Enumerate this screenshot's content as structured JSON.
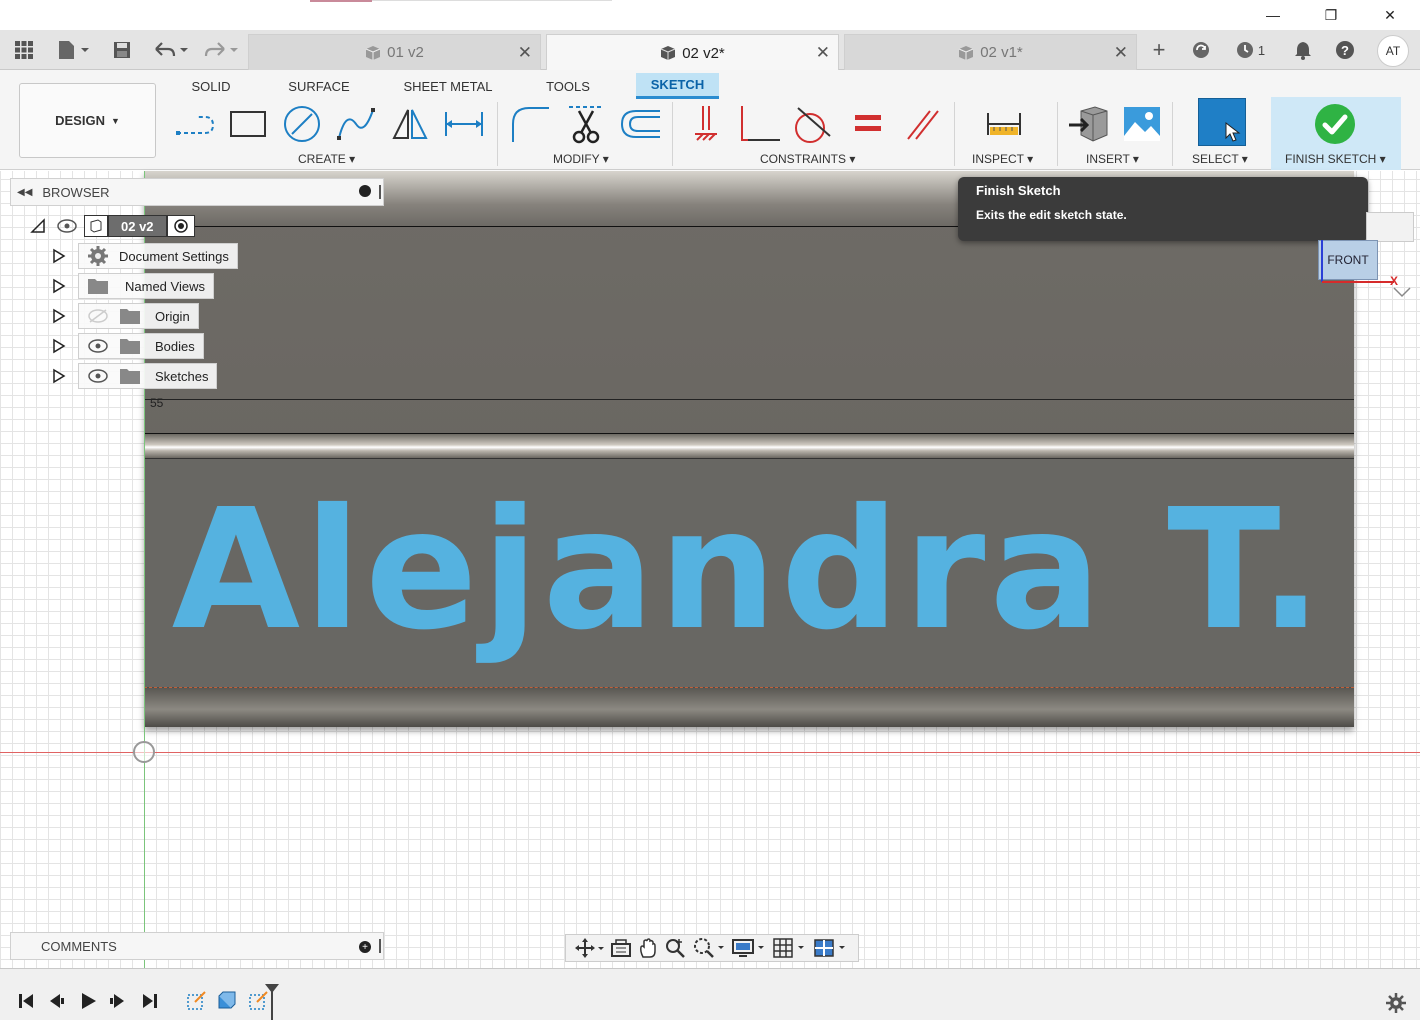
{
  "window": {
    "minimize": "—",
    "restore": "❐",
    "close": "✕"
  },
  "quick_access": {
    "apps_icon": "grid-icon",
    "file_icon": "file-icon",
    "save_icon": "save-icon",
    "undo_icon": "undo-icon",
    "redo_icon": "redo-icon"
  },
  "tabs": [
    {
      "label": "01 v2",
      "active": false
    },
    {
      "label": "02 v2*",
      "active": true
    },
    {
      "label": "02 v1*",
      "active": false
    }
  ],
  "top_right": {
    "job_count": "1",
    "user_initials": "AT"
  },
  "ribbon": {
    "workspace": "DESIGN",
    "tabs": [
      "SOLID",
      "SURFACE",
      "SHEET METAL",
      "TOOLS",
      "SKETCH"
    ],
    "active_tab": "SKETCH",
    "groups": {
      "create": "CREATE",
      "modify": "MODIFY",
      "constraints": "CONSTRAINTS",
      "inspect": "INSPECT",
      "insert": "INSERT",
      "select": "SELECT",
      "finish": "FINISH SKETCH"
    },
    "accent_color": "#2a8cd0"
  },
  "browser": {
    "title": "BROWSER",
    "root": "02 v2",
    "items": [
      {
        "label": "Document Settings",
        "icon": "gear-icon"
      },
      {
        "label": "Named Views",
        "icon": "folder-icon"
      },
      {
        "label": "Origin",
        "icon": "folder-icon",
        "visibility": "hidden"
      },
      {
        "label": "Bodies",
        "icon": "folder-icon",
        "visibility": "visible"
      },
      {
        "label": "Sketches",
        "icon": "folder-icon",
        "visibility": "visible"
      }
    ]
  },
  "tooltip": {
    "title": "Finish Sketch",
    "text": "Exits the edit sketch state."
  },
  "viewcube": {
    "face": "FRONT",
    "axis_x": "X"
  },
  "canvas": {
    "sketch_text": "Alejandra T.",
    "sketch_color": "#55b2e0",
    "dimension_label": "55"
  },
  "comments": {
    "title": "COMMENTS"
  }
}
